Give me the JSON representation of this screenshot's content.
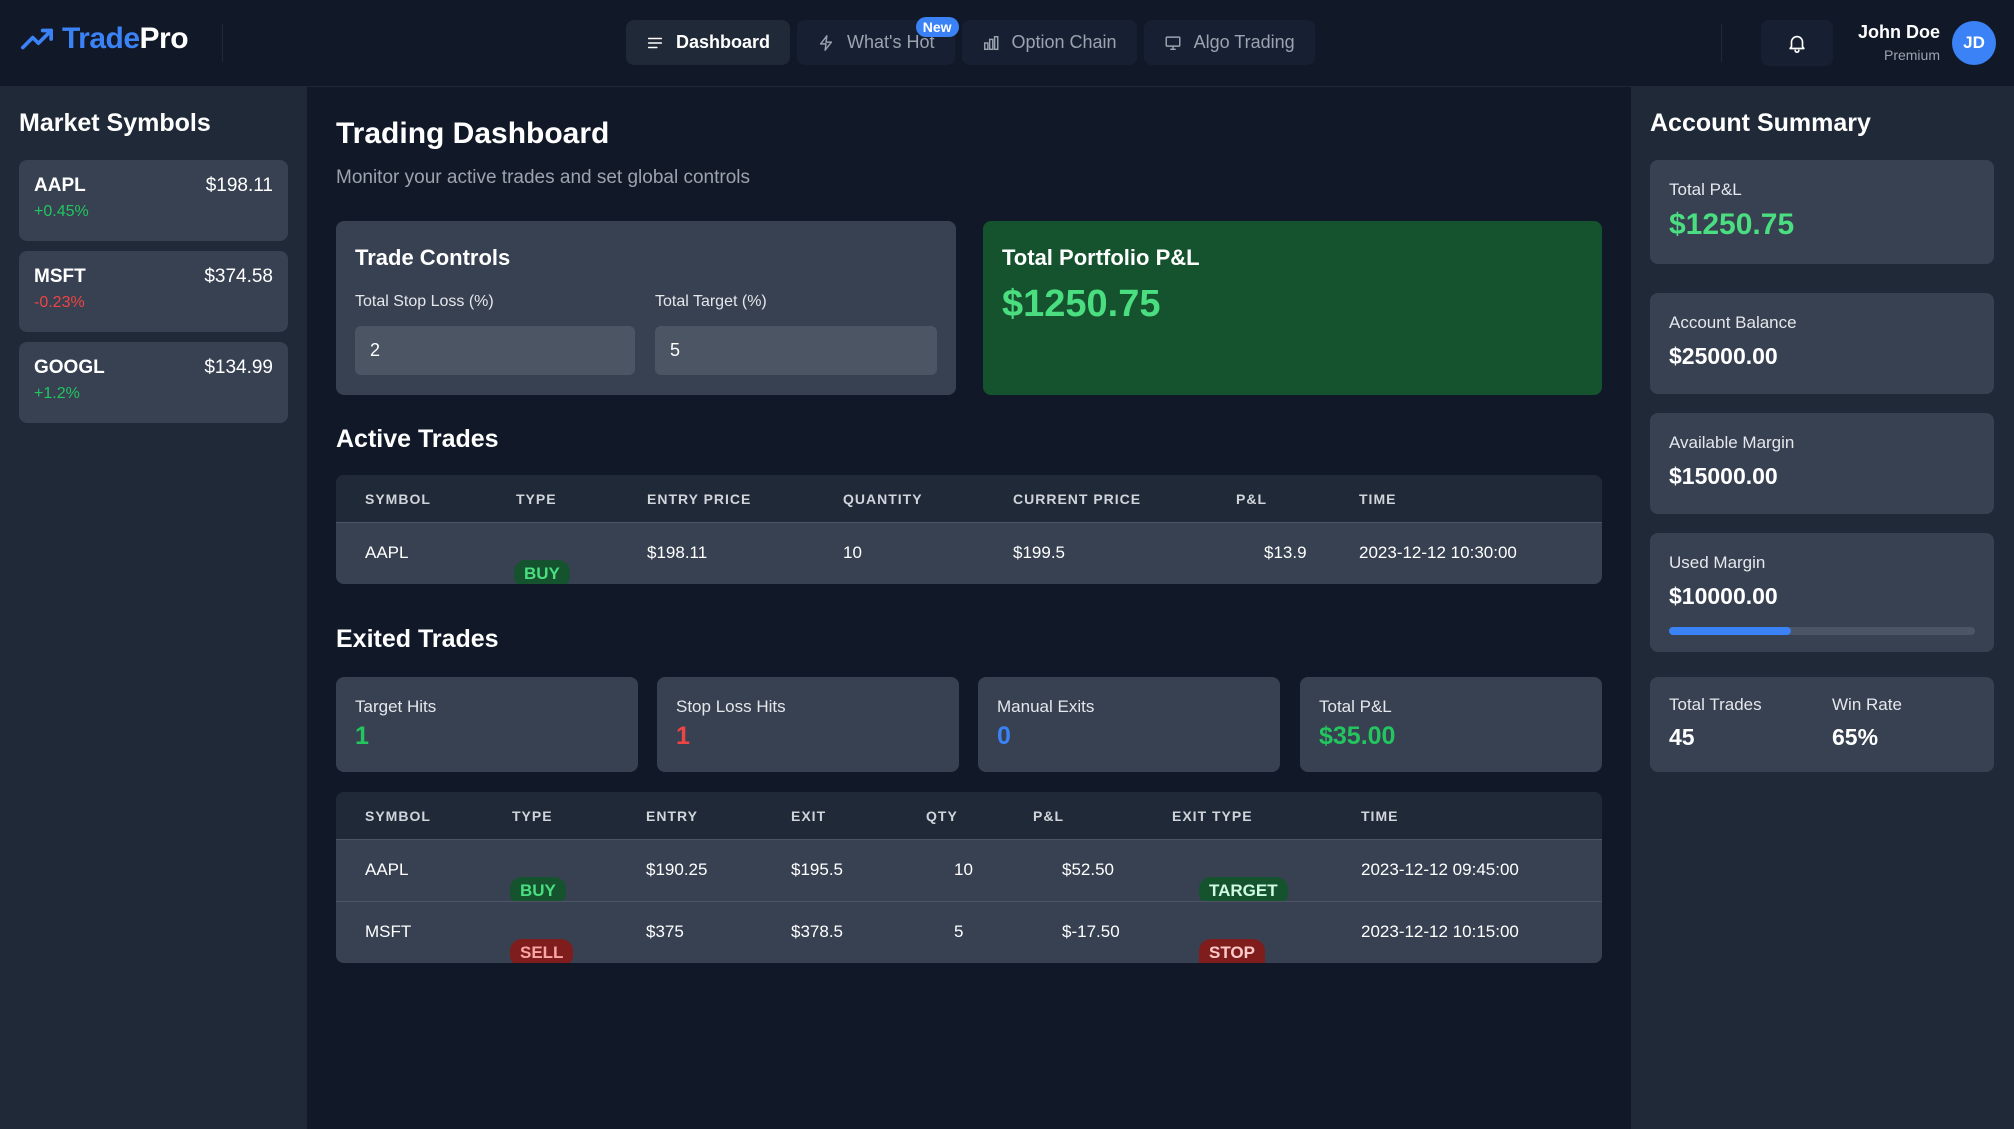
{
  "brand": {
    "part1": "Trade",
    "part2": "Pro"
  },
  "nav": [
    {
      "label": "Dashboard",
      "icon": "menu-icon",
      "active": true
    },
    {
      "label": "What's Hot",
      "icon": "lightning-icon",
      "badge": "New"
    },
    {
      "label": "Option Chain",
      "icon": "bar-chart-icon"
    },
    {
      "label": "Algo Trading",
      "icon": "monitor-icon"
    }
  ],
  "user": {
    "name": "John Doe",
    "tier": "Premium",
    "initials": "JD"
  },
  "market_symbols": {
    "title": "Market Symbols",
    "items": [
      {
        "symbol": "AAPL",
        "price": "$198.11",
        "change": "+0.45%",
        "direction": "up"
      },
      {
        "symbol": "MSFT",
        "price": "$374.58",
        "change": "-0.23%",
        "direction": "down"
      },
      {
        "symbol": "GOOGL",
        "price": "$134.99",
        "change": "+1.2%",
        "direction": "up"
      }
    ]
  },
  "main": {
    "title": "Trading Dashboard",
    "subtitle": "Monitor your active trades and set global controls",
    "trade_controls": {
      "title": "Trade Controls",
      "stop_loss_label": "Total Stop Loss (%)",
      "stop_loss_value": "2",
      "target_label": "Total Target (%)",
      "target_value": "5"
    },
    "portfolio": {
      "title": "Total Portfolio P&L",
      "value": "$1250.75"
    },
    "active_trades": {
      "title": "Active Trades",
      "columns": [
        "SYMBOL",
        "TYPE",
        "ENTRY PRICE",
        "QUANTITY",
        "CURRENT PRICE",
        "P&L",
        "TIME"
      ],
      "rows": [
        {
          "symbol": "AAPL",
          "type": "BUY",
          "entry": "$198.11",
          "qty": "10",
          "current": "$199.5",
          "pl": "$13.9",
          "time": "2023-12-12 10:30:00"
        }
      ]
    },
    "exited_trades": {
      "title": "Exited Trades",
      "stats": [
        {
          "label": "Target Hits",
          "value": "1",
          "tone": "green"
        },
        {
          "label": "Stop Loss Hits",
          "value": "1",
          "tone": "red"
        },
        {
          "label": "Manual Exits",
          "value": "0",
          "tone": "blue"
        },
        {
          "label": "Total P&L",
          "value": "$35.00",
          "tone": "green"
        }
      ],
      "columns": [
        "SYMBOL",
        "TYPE",
        "ENTRY",
        "EXIT",
        "QTY",
        "P&L",
        "EXIT TYPE",
        "TIME"
      ],
      "rows": [
        {
          "symbol": "AAPL",
          "type": "BUY",
          "entry": "$190.25",
          "exit": "$195.5",
          "qty": "10",
          "pl": "$52.50",
          "exit_type": "TARGET",
          "time": "2023-12-12 09:45:00"
        },
        {
          "symbol": "MSFT",
          "type": "SELL",
          "entry": "$375",
          "exit": "$378.5",
          "qty": "5",
          "pl": "$-17.50",
          "exit_type": "STOP LOSS",
          "time": "2023-12-12 10:15:00"
        }
      ]
    }
  },
  "account": {
    "title": "Account Summary",
    "total_pl_label": "Total P&L",
    "total_pl_value": "$1250.75",
    "balance_label": "Account Balance",
    "balance_value": "$25000.00",
    "available_label": "Available Margin",
    "available_value": "$15000.00",
    "used_label": "Used Margin",
    "used_value": "$10000.00",
    "used_fraction": 0.4,
    "trades_label": "Total Trades",
    "trades_value": "45",
    "winrate_label": "Win Rate",
    "winrate_value": "65%"
  },
  "colors": {
    "accent": "#3b82f6",
    "positive": "#22c55e",
    "negative": "#ef4444",
    "panel": "#374151"
  }
}
